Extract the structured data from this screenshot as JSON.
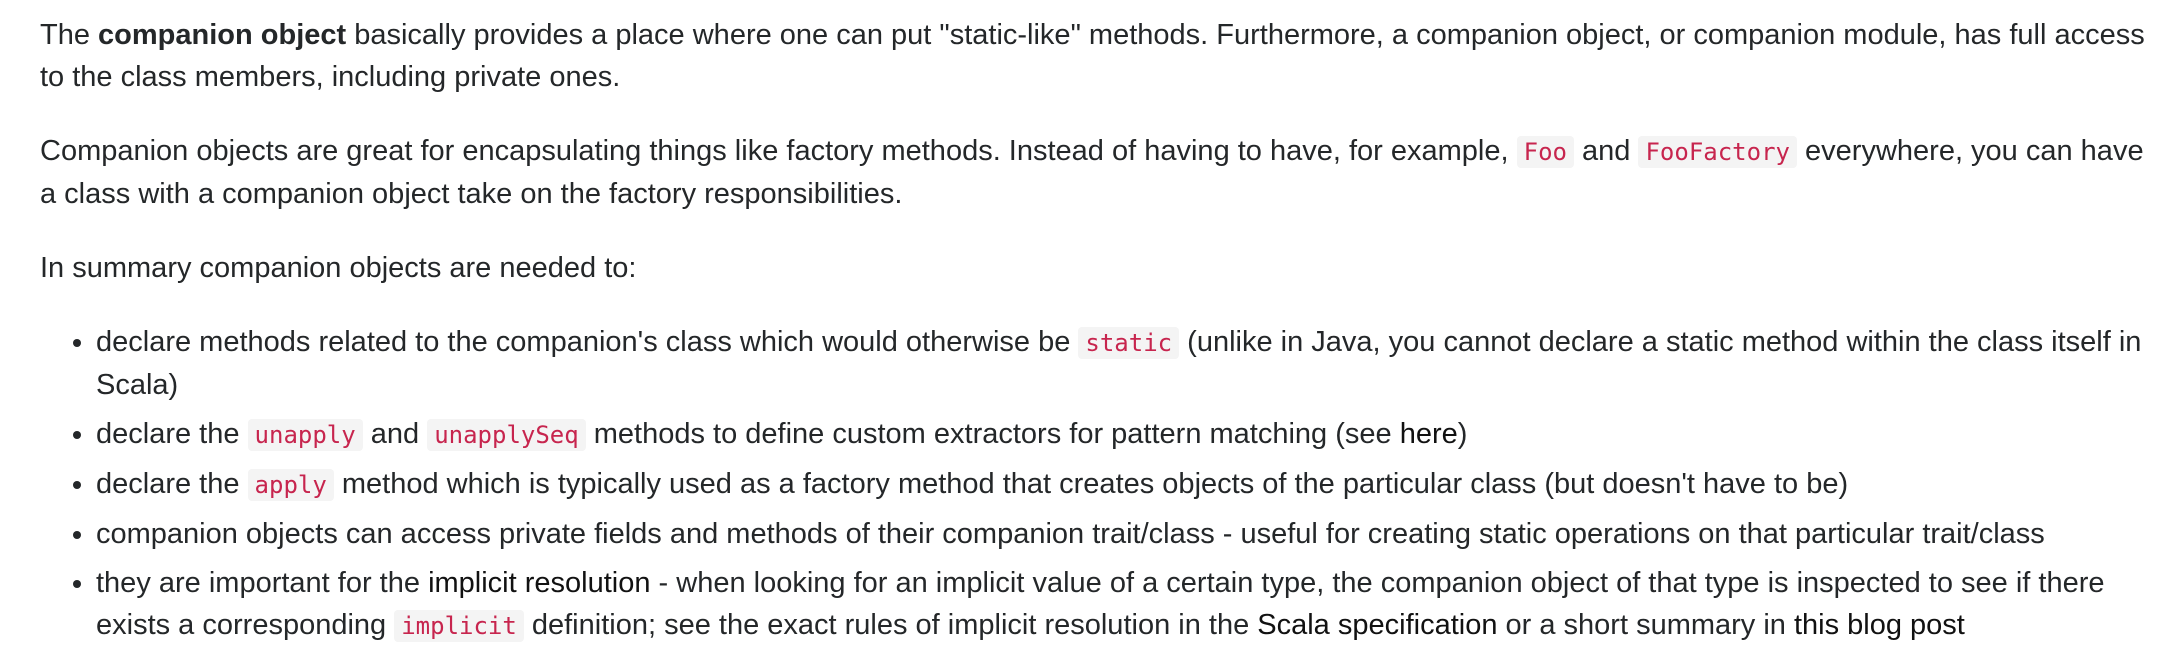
{
  "para1": {
    "prefix": "The ",
    "bold": "companion object",
    "suffix": " basically provides a place where one can put \"static-like\" methods. Furthermore, a companion object, or companion module, has full access to the class members, including private ones."
  },
  "para2": {
    "part1": "Companion objects are great for encapsulating things like factory methods. Instead of having to have, for example, ",
    "code1": "Foo",
    "part2": " and ",
    "code2": "FooFactory",
    "part3": " everywhere, you can have a class with a companion object take on the factory responsibilities."
  },
  "para3": "In summary companion objects are needed to:",
  "list": {
    "item1": {
      "part1": "declare methods related to the companion's class which would otherwise be ",
      "code": "static",
      "part2": " (unlike in Java, you cannot declare a static method within the class itself in Scala)"
    },
    "item2": {
      "part1": "declare the ",
      "code1": "unapply",
      "part2": " and ",
      "code2": "unapplySeq",
      "part3": " methods to define custom extractors for pattern matching (see ",
      "link": "here",
      "part4": ")"
    },
    "item3": {
      "part1": "declare the ",
      "code": "apply",
      "part2": " method which is typically used as a factory method that creates objects of the particular class (but doesn't have to be)"
    },
    "item4": "companion objects can access private fields and methods of their companion trait/class - useful for creating static operations on that particular trait/class",
    "item5": {
      "part1": "they are important for the ",
      "link1": "implicit resolution",
      "part2": " - when looking for an implicit value of a certain type, the companion object of that type is inspected to see if there exists a corresponding ",
      "code": "implicit",
      "part3": " definition; see the exact rules of implicit resolution in the ",
      "link2": "Scala specification",
      "part4": " or a short summary in ",
      "link3": "this blog post"
    }
  }
}
